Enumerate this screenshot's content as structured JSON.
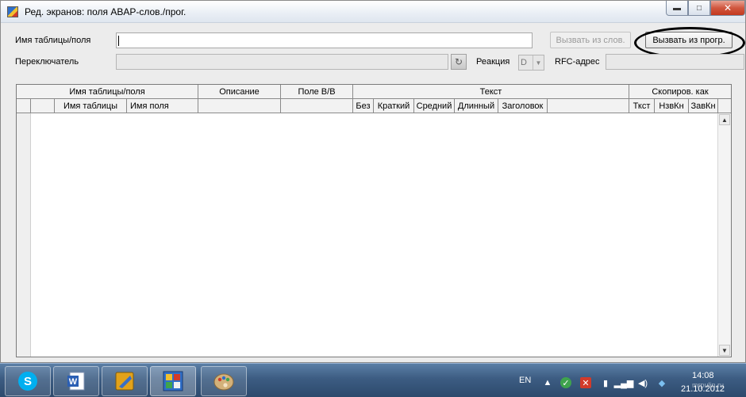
{
  "window": {
    "title": "Ред. экранов: поля ABAP-слов./прог.",
    "controls": {
      "minimize": "▬",
      "maximize": "□",
      "close": "✕"
    }
  },
  "form": {
    "table_field_label": "Имя таблицы/поля",
    "table_field_value": "",
    "switch_label": "Переключатель",
    "switch_value": "",
    "reaction_label": "Реакция",
    "reaction_value": "D",
    "rfc_label": "RFC-адрес",
    "rfc_value": "",
    "btn_call_from_dict": "Вызвать из слов.",
    "btn_call_from_prog": "Вызвать из прогр."
  },
  "grid": {
    "group_headers": [
      "Имя таблицы/поля",
      "Описание",
      "Поле В/В",
      "Текст",
      "Скопиров. как"
    ],
    "sub_headers": [
      "Имя таблицы",
      "Имя поля",
      "Без",
      "Краткий",
      "Средний",
      "Длинный",
      "Заголовок",
      "Ткст",
      "НзвКн",
      "ЗавКн"
    ]
  },
  "taskbar": {
    "apps": [
      {
        "name": "skype-icon",
        "glyph": "S",
        "color": "#00aff0"
      },
      {
        "name": "word-icon",
        "glyph": "W",
        "color": "#2b5fb4"
      },
      {
        "name": "sap-logon-icon",
        "glyph": "",
        "color": "#e2a21a"
      },
      {
        "name": "sap-gui-icon",
        "glyph": "",
        "color": "#2f6fc9"
      },
      {
        "name": "paint-icon",
        "glyph": "",
        "color": "#d3b17a"
      }
    ],
    "language": "EN",
    "time": "14:08",
    "date": "21.10.2012",
    "watermark": "mrpulin.ru"
  }
}
